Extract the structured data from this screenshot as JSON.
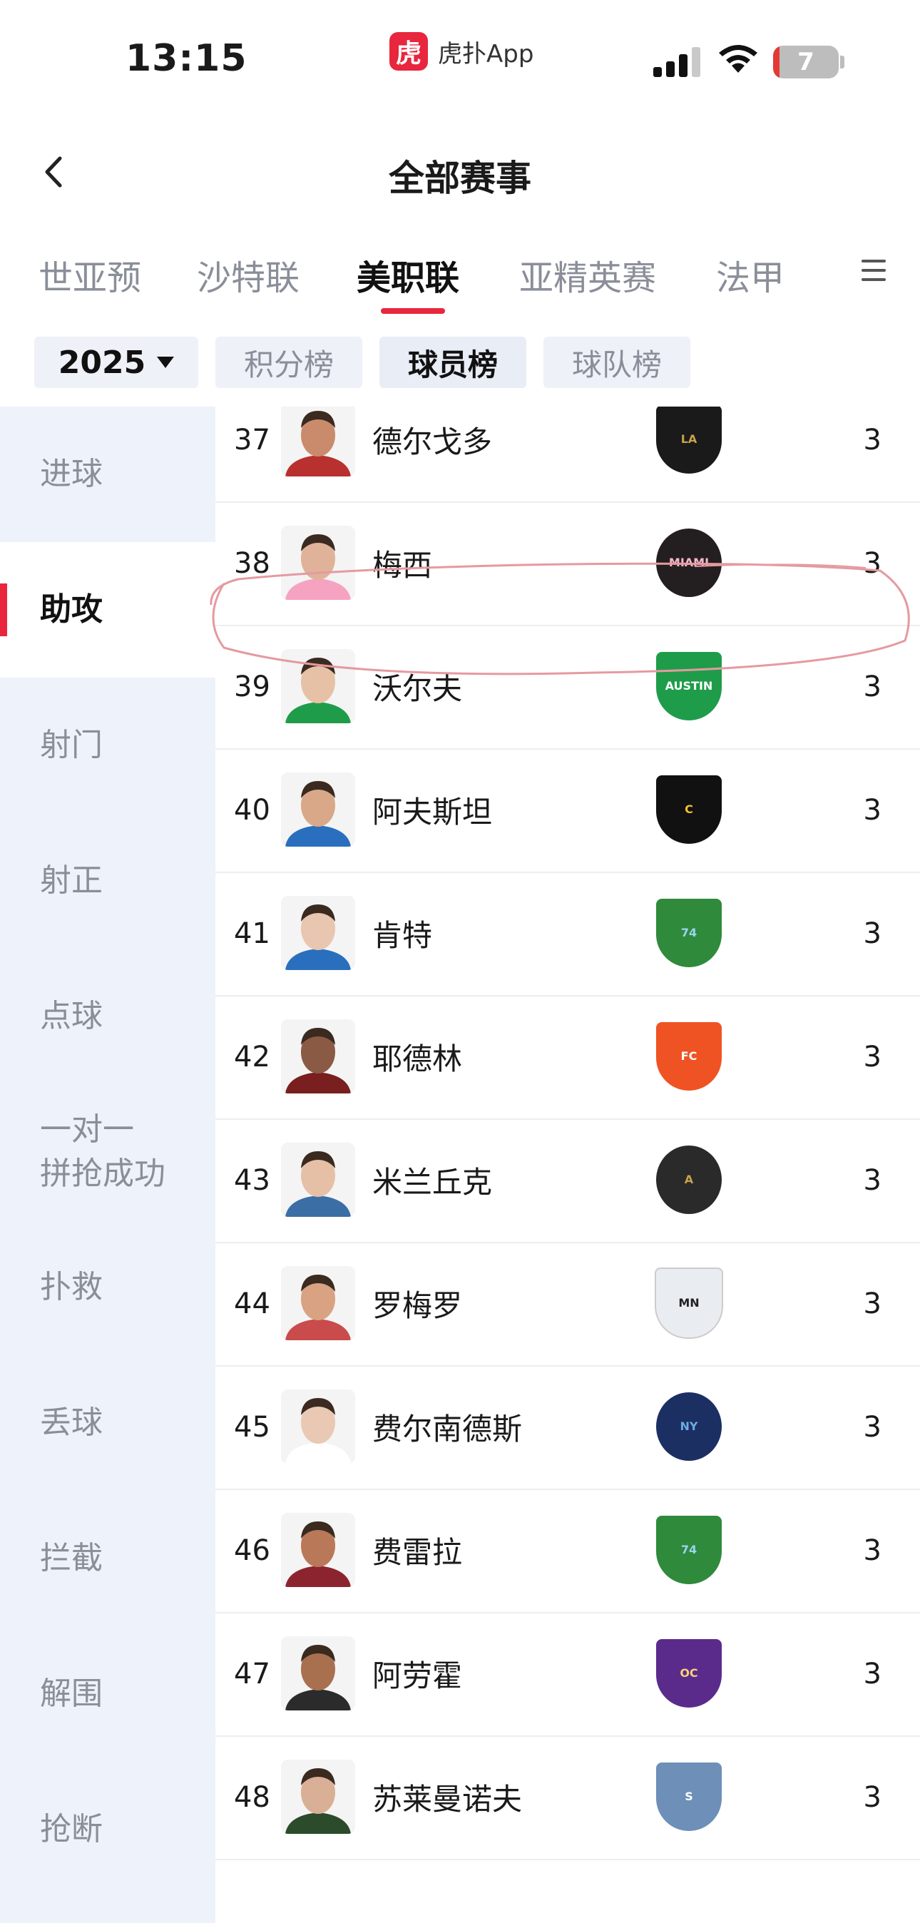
{
  "status_bar": {
    "time": "13:15",
    "app_logo": "虎",
    "app_name": "虎扑App",
    "battery": "7",
    "battery_level": 0.1
  },
  "nav": {
    "title": "全部赛事"
  },
  "league_tabs": [
    "世亚预",
    "沙特联",
    "美职联",
    "亚精英赛",
    "法甲"
  ],
  "active_league_index": 2,
  "filters": {
    "year": "2025",
    "options": [
      "积分榜",
      "球员榜",
      "球队榜"
    ],
    "active_index": 1
  },
  "sidebar": {
    "items": [
      "进球",
      "助攻",
      "射门",
      "射正",
      "点球",
      "一对一\n拼抢成功",
      "扑救",
      "丢球",
      "拦截",
      "解围",
      "抢断"
    ],
    "active_index": 1
  },
  "rows": [
    {
      "rank": "37",
      "name": "德尔戈多",
      "team_badge": "lafc-badge",
      "value": "3"
    },
    {
      "rank": "38",
      "name": "梅西",
      "team_badge": "inter-miami-badge",
      "value": "3",
      "highlighted": true
    },
    {
      "rank": "39",
      "name": "沃尔夫",
      "team_badge": "austin-fc-badge",
      "value": "3"
    },
    {
      "rank": "40",
      "name": "阿夫斯坦",
      "team_badge": "columbus-crew-badge",
      "value": "3"
    },
    {
      "rank": "41",
      "name": "肯特",
      "team_badge": "seattle-sounders-badge",
      "value": "3"
    },
    {
      "rank": "42",
      "name": "耶德林",
      "team_badge": "fc-cincinnati-badge",
      "value": "3"
    },
    {
      "rank": "43",
      "name": "米兰丘克",
      "team_badge": "atlanta-united-badge",
      "value": "3"
    },
    {
      "rank": "44",
      "name": "罗梅罗",
      "team_badge": "minnesota-united-badge",
      "value": "3"
    },
    {
      "rank": "45",
      "name": "费尔南德斯",
      "team_badge": "nycfc-badge",
      "value": "3"
    },
    {
      "rank": "46",
      "name": "费雷拉",
      "team_badge": "seattle-sounders-badge",
      "value": "3"
    },
    {
      "rank": "47",
      "name": "阿劳霍",
      "team_badge": "orlando-city-badge",
      "value": "3"
    },
    {
      "rank": "48",
      "name": "苏莱曼诺夫",
      "team_badge": "sporting-kc-badge",
      "value": "3"
    }
  ],
  "colors": {
    "accent": "#e8263d",
    "sidebar_bg": "#eef2fa",
    "chip_bg": "#eef1f7",
    "muted_text": "#8a8e99",
    "highlight_stroke": "#e59aa0"
  }
}
